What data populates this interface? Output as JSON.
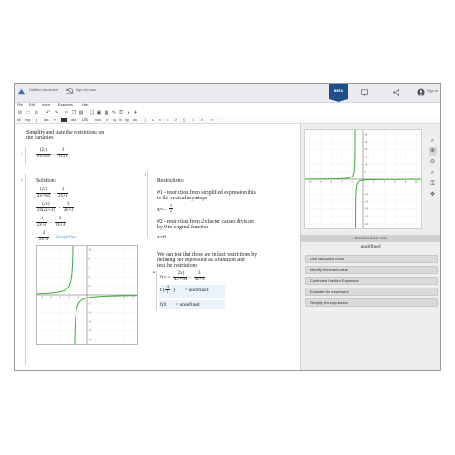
{
  "header": {
    "doc_title": "Untitled document",
    "sign_in_to_save": "Sign in to save",
    "beta": "BETA",
    "sign_in": "Sign in"
  },
  "menu": [
    "File",
    "Edit",
    "Insert",
    "Examples",
    "Help"
  ],
  "toolbar2": [
    "txt",
    "mg",
    "[ ]",
    "abs",
    "≡",
    "abc",
    "DES",
    "mod",
    "pl",
    "xy",
    "ln",
    "log",
    "log.",
    "∫",
    "≤",
    "±",
    "∞",
    "∂",
    "∑",
    "≈",
    "≠",
    "×",
    "⋅"
  ],
  "problem": {
    "line1": "Simplify and state the restrictions on",
    "line2": "the variables",
    "line_no_1": "1",
    "expr_num1": "(2x)",
    "expr_den1": "4x²+6x",
    "expr_num2": "3",
    "expr_den2": "2x+3"
  },
  "solution": {
    "line_no": "2",
    "title": "Solution:",
    "step1": {
      "n1": "(2x)",
      "d1": "4x²+6x",
      "n2": "3",
      "d2": "2x+3"
    },
    "step2": {
      "n1": "(2x)",
      "d1": "2x(2x+3)",
      "n2": "3",
      "d2": "2x+3"
    },
    "step3": {
      "n1": "1",
      "d1": "2x+3",
      "n2": "3",
      "d2": "2x+3"
    },
    "step4": {
      "n1": "2",
      "d1": "2x+3",
      "prefix": "−",
      "label": "Simplified"
    }
  },
  "restrictions": {
    "line_no": "3",
    "title": "Restrictions:",
    "r1_line1": "#1 - restriction from simplified expression this",
    "r1_line2": "is the vertical asymtope",
    "r1_eq": "x=−",
    "r1_num": "3",
    "r1_den": "2",
    "r2_line1": "#2 - restriction from 2x factor causes division",
    "r2_line2": "by 0 in original function",
    "r2_eq": "x=0",
    "test_line1": "We can test that these are in fact restrictions by",
    "test_line2": "defining our expression as a function and",
    "test_line3": "test the restrictions",
    "def_lhs": "f(x)=",
    "def_num1": "(2x)",
    "def_den1": "4x²+6x",
    "def_num2": "3",
    "def_den2": "2x+3",
    "eval1_lhs": "f",
    "eval1_num": "−3",
    "eval1_den": "2",
    "eval1_result": "= undefined",
    "eval2_lhs": "f(0)",
    "eval2_result": "= undefined"
  },
  "graph_small": {
    "x_ticks": [
      "-5",
      "-4",
      "-3",
      "-2",
      "-1",
      "1",
      "2",
      "3",
      "4",
      "5"
    ],
    "y_ticks": [
      "10",
      "8",
      "6",
      "4",
      "2",
      "-2",
      "-4",
      "-6",
      "-8",
      "-10"
    ]
  },
  "graph_right": {
    "x_ticks": [
      "-10",
      "-8",
      "-6",
      "-4",
      "-2",
      "2",
      "4",
      "6",
      "8",
      "10"
    ],
    "y_ticks": [
      "30",
      "25",
      "20",
      "15",
      "10",
      "5",
      "-5",
      "-10",
      "-15",
      "-20",
      "-25",
      "-30"
    ]
  },
  "operations": {
    "header": "OPERATIONS FOR:",
    "value": "undefined",
    "buttons": [
      "Use calculated result",
      "Identify the exact value",
      "Continued Fraction Expansion",
      "Evaluate the expression",
      "Simplify the expression"
    ]
  },
  "colors": {
    "curve": "#3caa3c",
    "accent": "#1e4f8c",
    "highlight": "#3f8fd8"
  }
}
